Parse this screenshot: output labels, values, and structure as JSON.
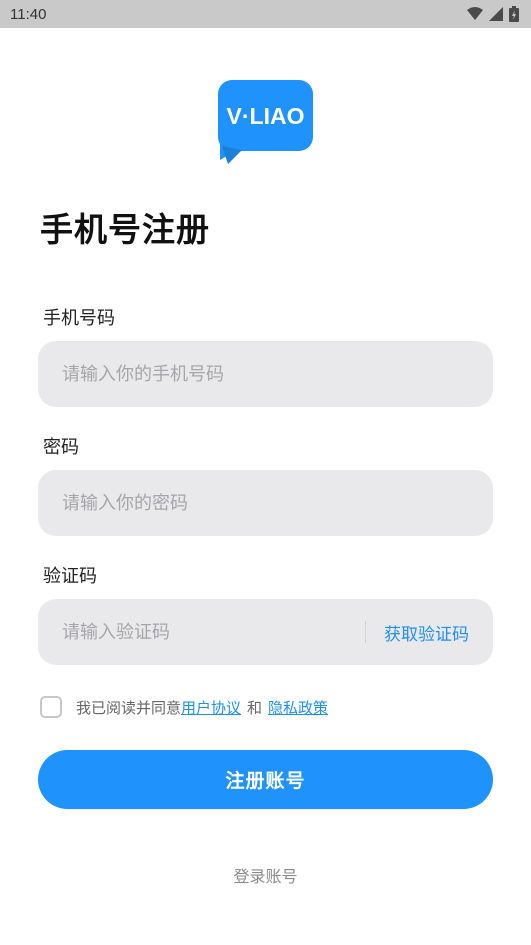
{
  "status_bar": {
    "time": "11:40",
    "icons": [
      "wifi-icon",
      "signal-icon",
      "battery-icon"
    ]
  },
  "logo": {
    "text": "V·LIAO",
    "color": "#1f93fb"
  },
  "title": "手机号注册",
  "phone": {
    "label": "手机号码",
    "placeholder": "请输入你的手机号码"
  },
  "password": {
    "label": "密码",
    "placeholder": "请输入你的密码"
  },
  "verify": {
    "label": "验证码",
    "placeholder": "请输入验证码",
    "button": "获取验证码"
  },
  "agreement": {
    "prefix": "我已阅读并同意",
    "user_agreement": "用户协议",
    "and": "和",
    "privacy_policy": "隐私政策",
    "checked": false
  },
  "register_button": "注册账号",
  "login_link": "登录账号",
  "colors": {
    "accent": "#1f93fb",
    "input_bg": "#e9e9ec",
    "status_bar": "#c9c9c9"
  }
}
